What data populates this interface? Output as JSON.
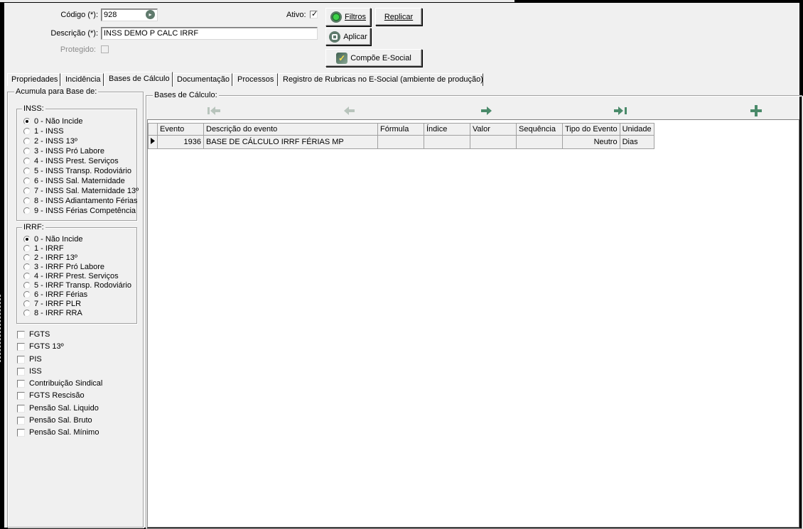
{
  "form": {
    "codigo_label": "Código (*):",
    "codigo_value": "928",
    "descricao_label": "Descrição (*):",
    "descricao_value": "INSS DEMO P CALC IRRF",
    "protegido_label": "Protegido:",
    "ativo_label": "Ativo:",
    "ativo_checked": "✓"
  },
  "buttons": {
    "filtros": "Filtros",
    "aplicar": "Aplicar",
    "replicar": "Replicar",
    "compoe": "Compõe E-Social"
  },
  "tabs": [
    "Propriedades",
    "Incidência",
    "Bases de Cálculo",
    "Documentação",
    "Processos",
    "Registro de Rubricas no E-Social (ambiente de produção)"
  ],
  "left": {
    "title": "Acumula para Base de:",
    "inss_title": "INSS:",
    "inss_options": [
      "0 - Não Incide",
      "1 - INSS",
      "2 - INSS 13º",
      "3 - INSS Pró Labore",
      "4 - INSS Prest. Serviços",
      "5 - INSS Transp. Rodoviário",
      "6 - INSS Sal. Maternidade",
      "7 - INSS Sal. Maternidade 13º",
      "8 - INSS Adiantamento Férias",
      "9 - INSS Férias Competência"
    ],
    "irrf_title": "IRRF:",
    "irrf_options": [
      "0 - Não Incide",
      "1 - IRRF",
      "2 - IRRF 13º",
      "3 - IRRF Pró Labore",
      "4 - IRRF Prest. Serviços",
      "5 - IRRF Transp. Rodoviário",
      "6 - IRRF Férias",
      "7 - IRRF PLR",
      "8 - IRRF RRA"
    ],
    "checkboxes": [
      "FGTS",
      "FGTS 13º",
      "PIS",
      "ISS",
      "Contribuição Sindical",
      "FGTS Rescisão",
      "Pensão Sal. Liquido",
      "Pensão Sal. Bruto",
      "Pensão Sal. Mínimo"
    ]
  },
  "right": {
    "title": "Bases de Cálculo:",
    "columns": [
      "Evento",
      "Descrição do evento",
      "Fórmula",
      "Índice",
      "Valor",
      "Sequência",
      "Tipo do Evento",
      "Unidade"
    ],
    "rows": [
      {
        "evento": "1936",
        "descricao": "BASE DE CÁLCULO IRRF FÉRIAS MP",
        "formula": "",
        "indice": "",
        "valor": "",
        "sequencia": "",
        "tipo": "Neutro",
        "unidade": "Dias"
      }
    ]
  },
  "colors": {
    "nav_active": "#4a8a6a",
    "nav_disabled": "#b8c4bc"
  }
}
